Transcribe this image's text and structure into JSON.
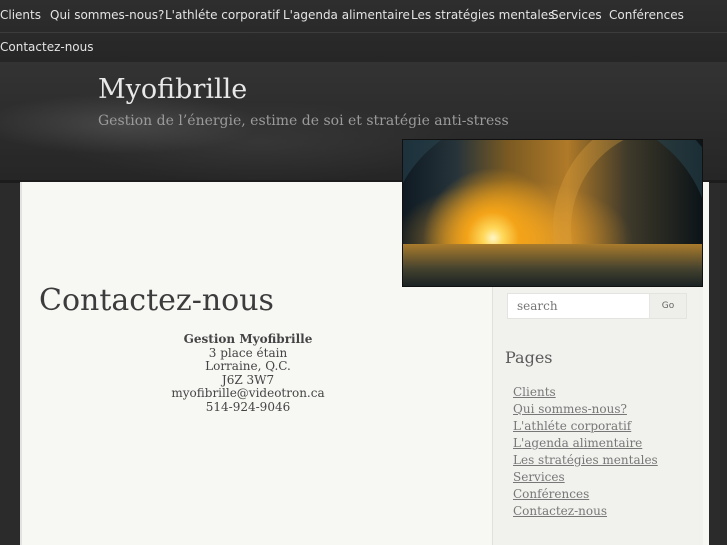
{
  "nav": {
    "items": [
      "Clients",
      "Qui sommes-nous?",
      "L'athléte corporatif",
      "L'agenda alimentaire",
      "Les stratégies mentales",
      "Services",
      "Conférences",
      "Contactez-nous"
    ]
  },
  "site": {
    "title": "Myofibrille",
    "description": "Gestion de l’énergie, estime de soi et stratégie anti-stress"
  },
  "main": {
    "title": "Contactez-nous",
    "address": {
      "name": "Gestion Myofibrille",
      "street": "3 place étain",
      "city": "Lorraine, Q.C.",
      "postal": "J6Z 3W7",
      "email": "myofibrille@videotron.ca",
      "phone": "514-924-9046"
    }
  },
  "sidebar": {
    "search": {
      "placeholder": "search",
      "button": "Go"
    },
    "pages_title": "Pages",
    "pages": [
      "Clients",
      "Qui sommes-nous?",
      "L'athléte corporatif",
      "L'agenda alimentaire",
      "Les stratégies mentales",
      "Services",
      "Conférences",
      "Contactez-nous"
    ]
  },
  "colors": {
    "background": "#2b2b2b",
    "paper": "#f7f8f4",
    "link": "#777777"
  }
}
